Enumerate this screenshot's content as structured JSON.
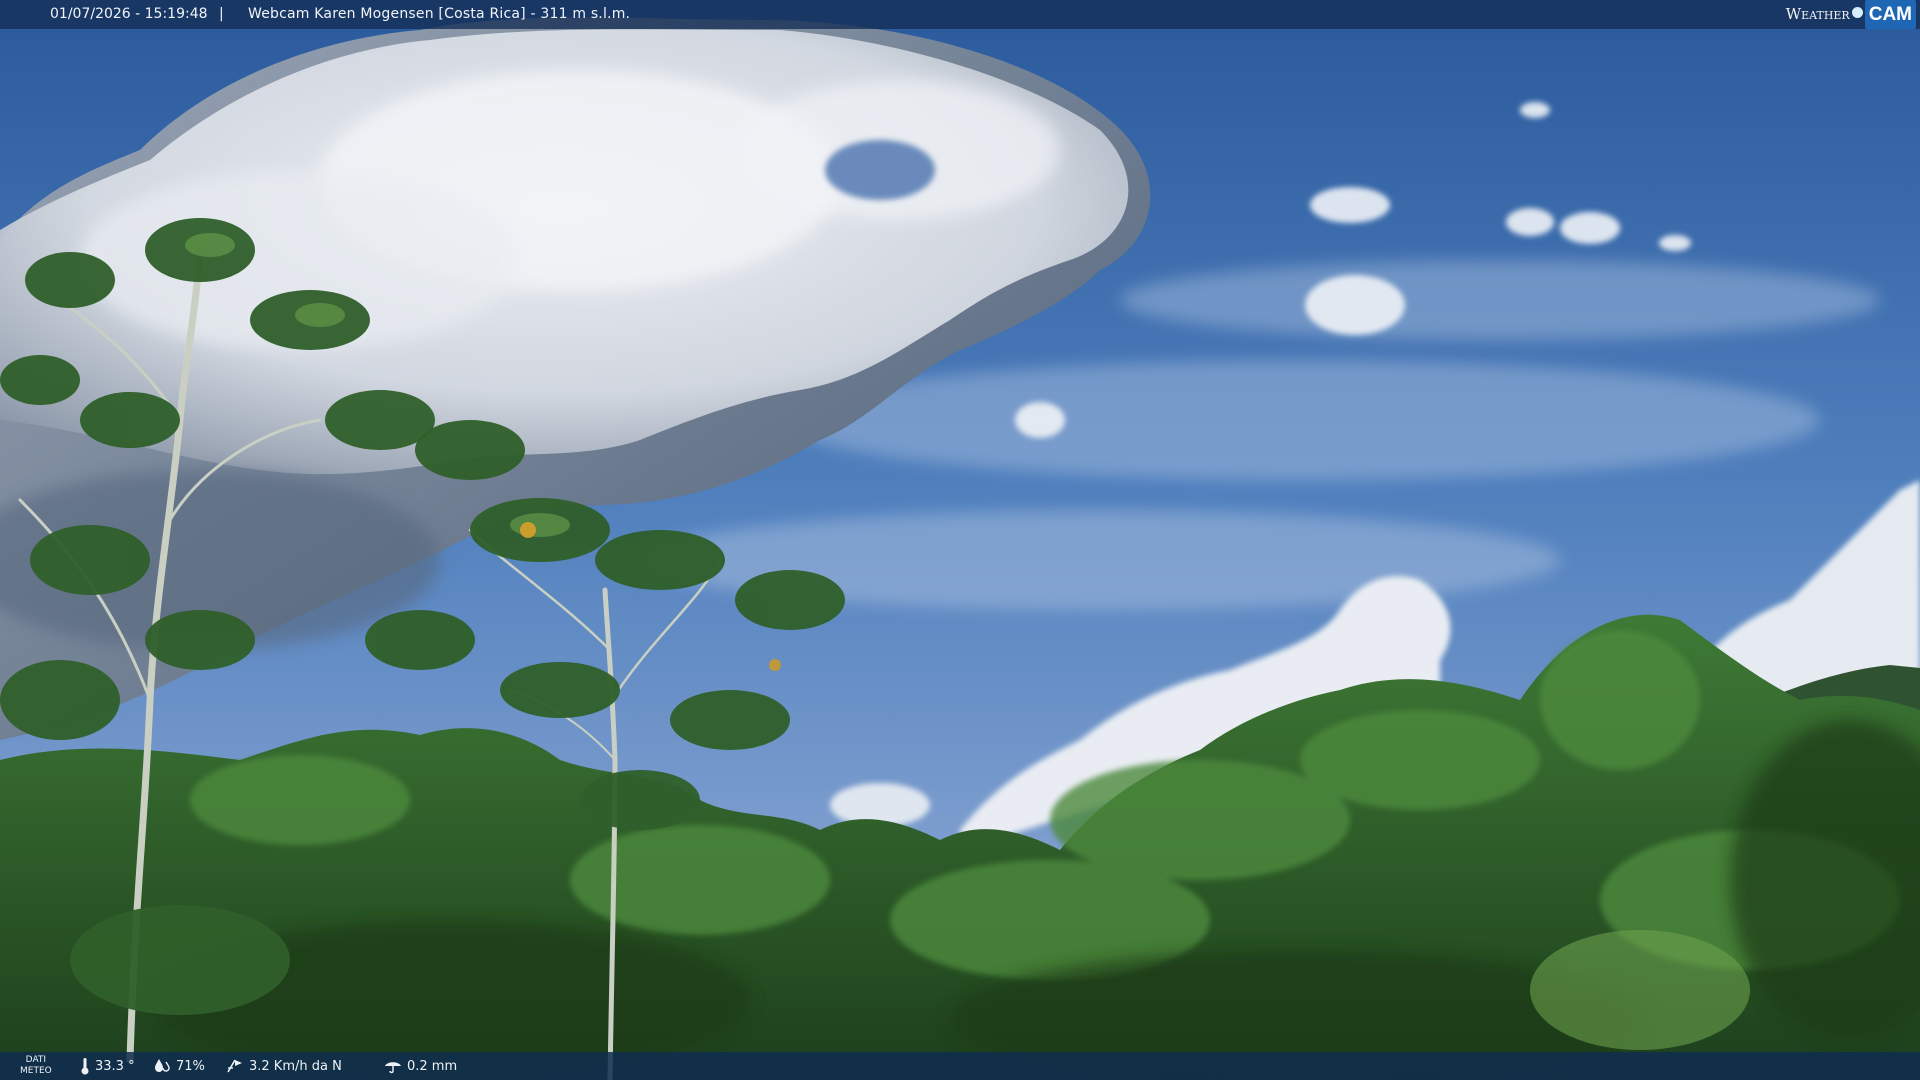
{
  "overlay": {
    "timestamp": "01/07/2026 - 15:19:48",
    "separator": "|",
    "title": "Webcam Karen Mogensen [Costa Rica] - 311 m s.l.m."
  },
  "logo": {
    "weather": "Weather",
    "cam": "CAM",
    "accent": "#1f67b5"
  },
  "weather_bar": {
    "label_line1": "DATI",
    "label_line2": "METEO",
    "temperature": "33.3 °",
    "humidity": "71%",
    "wind": "3.2 Km/h da N",
    "rain": "0.2 mm",
    "icons": [
      "thermometer-icon",
      "humidity-icon",
      "wind-icon",
      "rain-icon"
    ]
  }
}
